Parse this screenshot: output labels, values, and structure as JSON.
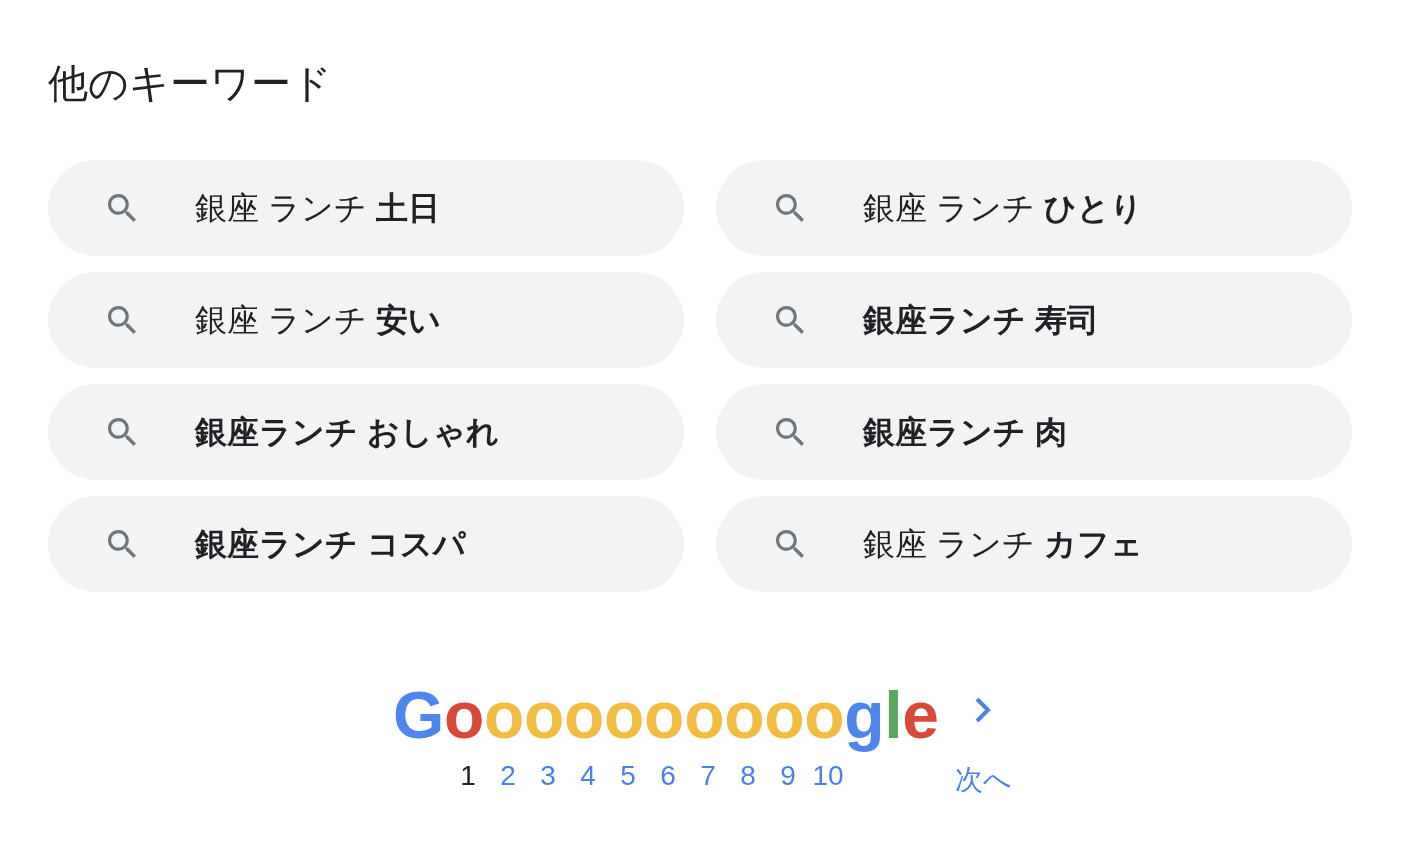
{
  "heading": "他のキーワード",
  "suggestions": [
    {
      "text": "銀座 ランチ **土日**",
      "bold": false
    },
    {
      "text": "銀座 ランチ **ひとり**",
      "bold": false
    },
    {
      "text": "銀座 ランチ **安い**",
      "bold": false
    },
    {
      "text": "銀座ランチ 寿司",
      "bold": true
    },
    {
      "text": "銀座ランチ おしゃれ",
      "bold": true
    },
    {
      "text": "銀座ランチ 肉",
      "bold": true
    },
    {
      "text": "銀座ランチ コスパ",
      "bold": true
    },
    {
      "text": "銀座 ランチ **カフェ**",
      "bold": false
    }
  ],
  "pagination": {
    "logo": {
      "segments": [
        {
          "text": "G",
          "color": "#4f86ec"
        },
        {
          "text": "o",
          "color": "#d9493a"
        },
        {
          "text": "ooooooooo",
          "color": "#f2bc42"
        },
        {
          "text": "g",
          "color": "#4f86ec"
        },
        {
          "text": "l",
          "color": "#58a65c"
        },
        {
          "text": "e",
          "color": "#d9493a"
        }
      ]
    },
    "pages": [
      {
        "label": "1",
        "selected": true
      },
      {
        "label": "2",
        "selected": false
      },
      {
        "label": "3",
        "selected": false
      },
      {
        "label": "4",
        "selected": false
      },
      {
        "label": "5",
        "selected": false
      },
      {
        "label": "6",
        "selected": false
      },
      {
        "label": "7",
        "selected": false
      },
      {
        "label": "8",
        "selected": false
      },
      {
        "label": "9",
        "selected": false
      },
      {
        "label": "10",
        "selected": false
      }
    ],
    "next": {
      "label": "次へ"
    }
  }
}
